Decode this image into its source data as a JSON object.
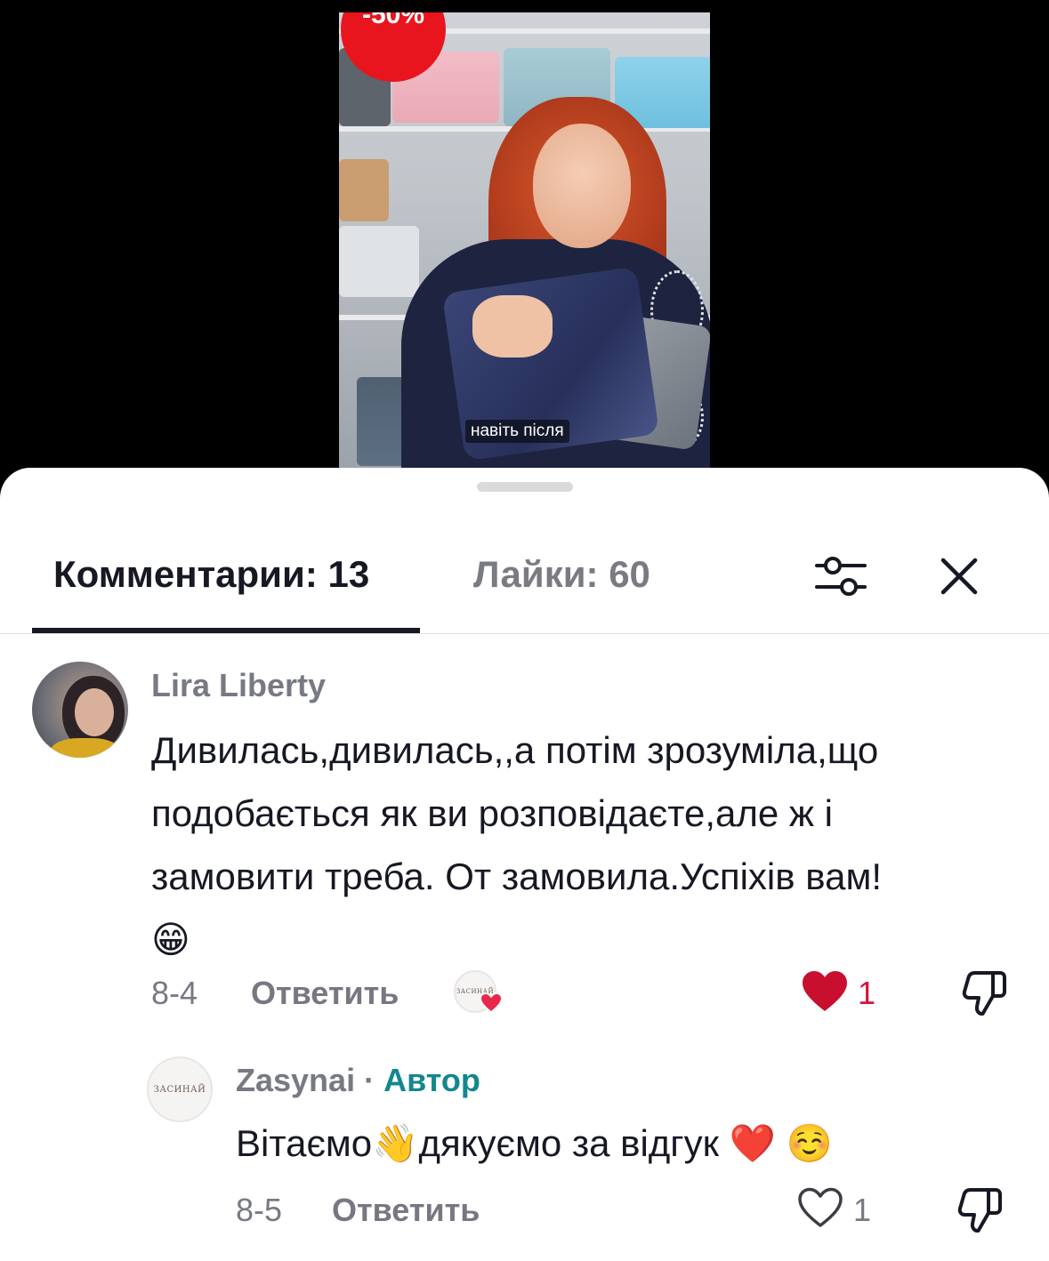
{
  "video": {
    "badge_text": "-50%",
    "caption": "навіть після"
  },
  "tabs": {
    "comments_label": "Комментарии: 13",
    "likes_label": "Лайки: 60"
  },
  "comments": [
    {
      "username": "Lira Liberty",
      "text_lines": [
        "Дивилась,дивилась,,а потім зрозуміла,що",
        "подобається як ви розповідаєте,але ж і",
        "замовити треба. От замовила.Успіхів вам!"
      ],
      "text_emoji": "😁",
      "date": "8-4",
      "reply_label": "Ответить",
      "creator_liked_avatar_text": "ЗАСИНАЙ",
      "like_count": "1",
      "liked": true
    },
    {
      "username": "Zasynai",
      "separator": " · ",
      "author_label": "Автор",
      "avatar_text": "ЗАСИНАЙ",
      "text_before": "Вітаємо",
      "emoji_wave": "👋",
      "text_after": "дякуємо за відгук ",
      "emoji_heart": "❤️",
      "emoji_smile": "☺️",
      "date": "8-5",
      "reply_label": "Ответить",
      "like_count": "1",
      "liked": false
    }
  ],
  "colors": {
    "heart_red": "#d6153a",
    "author_teal": "#14868e",
    "muted_text": "#777983",
    "badge_red": "#e8151e"
  },
  "icons": [
    "filter-icon",
    "close-icon",
    "heart-icon",
    "dislike-icon"
  ]
}
